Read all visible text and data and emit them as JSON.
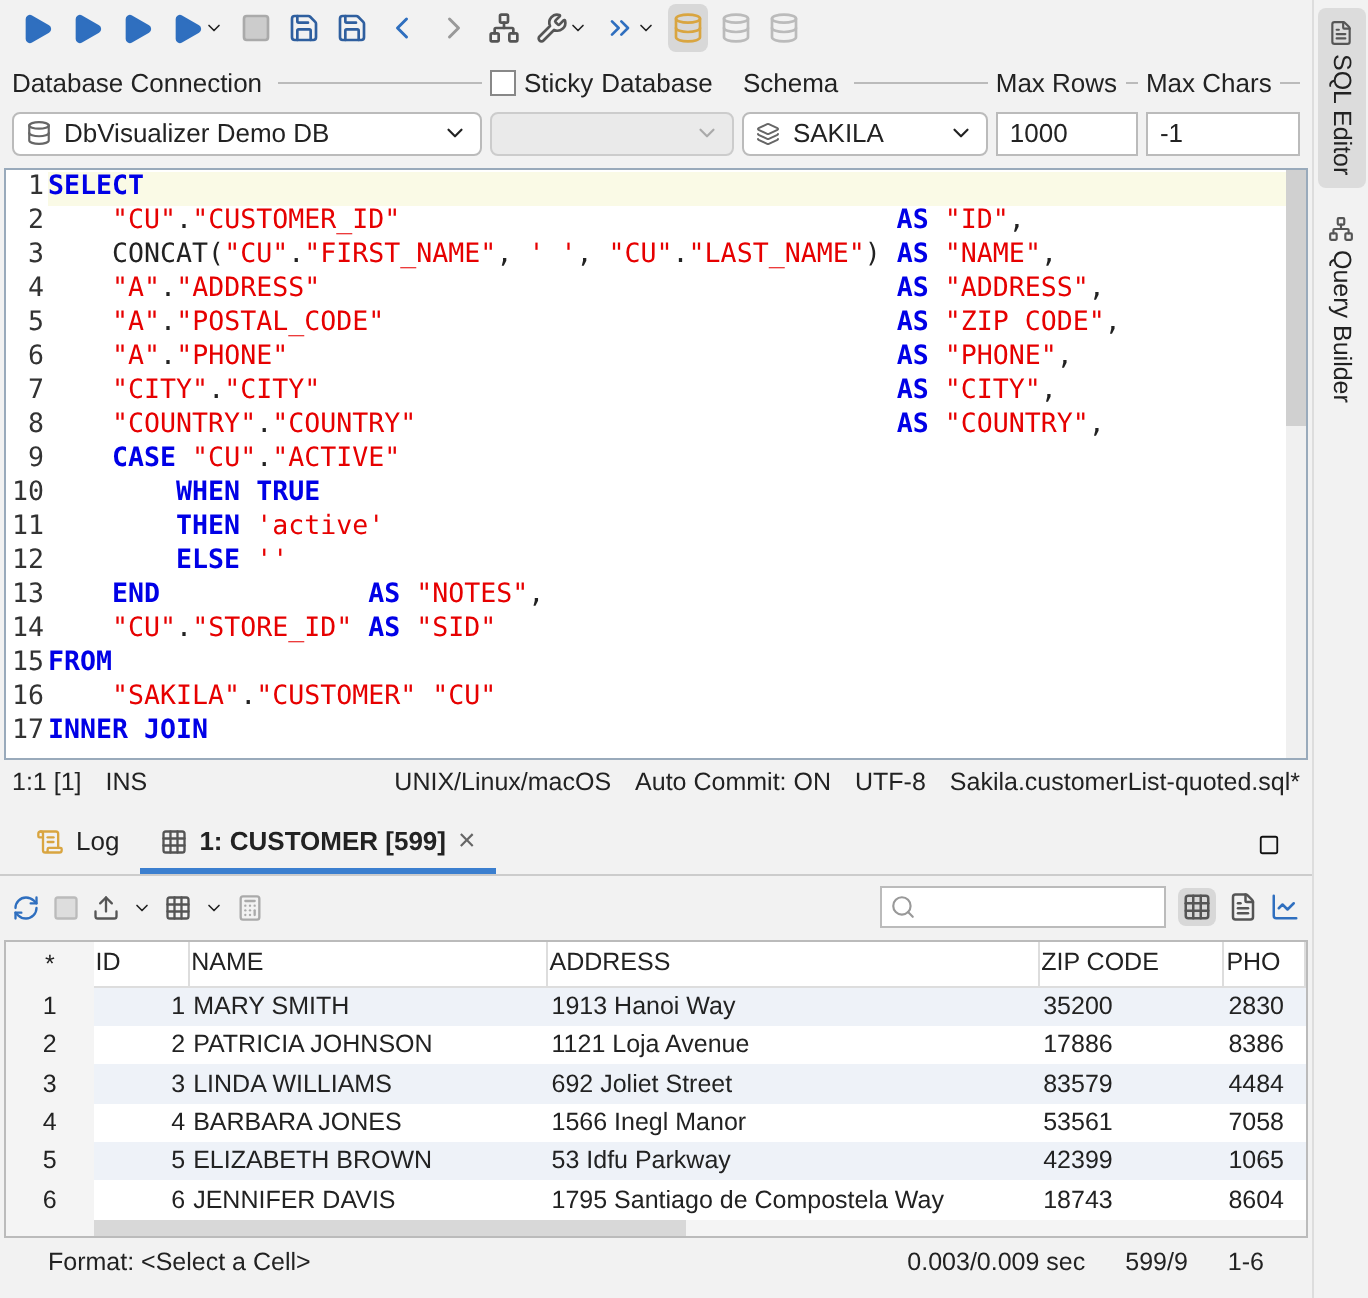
{
  "connection": {
    "label": "Database Connection",
    "value": "DbVisualizer Demo DB",
    "sticky": {
      "label": "Sticky",
      "checked": false
    }
  },
  "database": {
    "label": "Database"
  },
  "schema": {
    "label": "Schema",
    "value": "SAKILA"
  },
  "max_rows": {
    "label": "Max Rows",
    "value": "1000"
  },
  "max_chars": {
    "label": "Max Chars",
    "value": "-1"
  },
  "side_tabs": [
    {
      "label": "SQL Editor",
      "selected": true
    },
    {
      "label": "Query Builder",
      "selected": false
    }
  ],
  "editor": {
    "lines": [
      {
        "number": "1",
        "tokens": [
          {
            "kind": "kw",
            "text": "SELECT"
          }
        ]
      },
      {
        "number": "2",
        "tokens": [
          {
            "kind": "str",
            "text": "    \"CU\"",
            "suffix": "."
          },
          {
            "kind": "str",
            "text": "\"CUSTOMER_ID\""
          },
          {
            "kind": "kw",
            "text": "                               AS"
          },
          {
            "kind": "str",
            "text": " \"ID\"",
            "suffix": ","
          }
        ]
      },
      {
        "number": "3",
        "tokens": [
          {
            "kind": "plain",
            "text": "    CONCAT("
          },
          {
            "kind": "str",
            "text": "\"CU\"",
            "suffix": "."
          },
          {
            "kind": "str",
            "text": "\"FIRST_NAME\"",
            "suffix": ", "
          },
          {
            "kind": "str",
            "text": "' '",
            "suffix": ", "
          },
          {
            "kind": "str",
            "text": "\"CU\"",
            "suffix": "."
          },
          {
            "kind": "str",
            "text": "\"LAST_NAME\"",
            "suffix": ")"
          },
          {
            "kind": "kw",
            "text": " AS"
          },
          {
            "kind": "str",
            "text": " \"NAME\"",
            "suffix": ","
          }
        ]
      },
      {
        "number": "4",
        "tokens": [
          {
            "kind": "str",
            "text": "    \"A\"",
            "suffix": "."
          },
          {
            "kind": "str",
            "text": "\"ADDRESS\""
          },
          {
            "kind": "kw",
            "text": "                                    AS"
          },
          {
            "kind": "str",
            "text": " \"ADDRESS\"",
            "suffix": ","
          }
        ]
      },
      {
        "number": "5",
        "tokens": [
          {
            "kind": "str",
            "text": "    \"A\"",
            "suffix": "."
          },
          {
            "kind": "str",
            "text": "\"POSTAL_CODE\""
          },
          {
            "kind": "kw",
            "text": "                                AS"
          },
          {
            "kind": "str",
            "text": " \"ZIP CODE\"",
            "suffix": ","
          }
        ]
      },
      {
        "number": "6",
        "tokens": [
          {
            "kind": "str",
            "text": "    \"A\"",
            "suffix": "."
          },
          {
            "kind": "str",
            "text": "\"PHONE\""
          },
          {
            "kind": "kw",
            "text": "                                      AS"
          },
          {
            "kind": "str",
            "text": " \"PHONE\"",
            "suffix": ","
          }
        ]
      },
      {
        "number": "7",
        "tokens": [
          {
            "kind": "str",
            "text": "    \"CITY\"",
            "suffix": "."
          },
          {
            "kind": "str",
            "text": "\"CITY\""
          },
          {
            "kind": "kw",
            "text": "                                    AS"
          },
          {
            "kind": "str",
            "text": " \"CITY\"",
            "suffix": ","
          }
        ]
      },
      {
        "number": "8",
        "tokens": [
          {
            "kind": "str",
            "text": "    \"COUNTRY\"",
            "suffix": "."
          },
          {
            "kind": "str",
            "text": "\"COUNTRY\""
          },
          {
            "kind": "kw",
            "text": "                              AS"
          },
          {
            "kind": "str",
            "text": " \"COUNTRY\"",
            "suffix": ","
          }
        ]
      },
      {
        "number": "9",
        "tokens": [
          {
            "kind": "kw",
            "text": "    CASE"
          },
          {
            "kind": "str",
            "text": " \"CU\"",
            "suffix": "."
          },
          {
            "kind": "str",
            "text": "\"ACTIVE\""
          }
        ]
      },
      {
        "number": "10",
        "tokens": [
          {
            "kind": "kw",
            "text": "        WHEN TRUE"
          }
        ]
      },
      {
        "number": "11",
        "tokens": [
          {
            "kind": "kw",
            "text": "        THEN"
          },
          {
            "kind": "str",
            "text": " 'active'"
          }
        ]
      },
      {
        "number": "12",
        "tokens": [
          {
            "kind": "kw",
            "text": "        ELSE"
          },
          {
            "kind": "str",
            "text": " ''"
          }
        ]
      },
      {
        "number": "13",
        "tokens": [
          {
            "kind": "kw",
            "text": "    END             AS"
          },
          {
            "kind": "str",
            "text": " \"NOTES\"",
            "suffix": ","
          }
        ]
      },
      {
        "number": "14",
        "tokens": [
          {
            "kind": "str",
            "text": "    \"CU\"",
            "suffix": "."
          },
          {
            "kind": "str",
            "text": "\"STORE_ID\""
          },
          {
            "kind": "kw",
            "text": " AS"
          },
          {
            "kind": "str",
            "text": " \"SID\""
          }
        ]
      },
      {
        "number": "15",
        "tokens": [
          {
            "kind": "kw",
            "text": "FROM"
          }
        ]
      },
      {
        "number": "16",
        "tokens": [
          {
            "kind": "str",
            "text": "    \"SAKILA\"",
            "suffix": "."
          },
          {
            "kind": "str",
            "text": "\"CUSTOMER\" \"CU\""
          }
        ]
      },
      {
        "number": "17",
        "tokens": [
          {
            "kind": "kw",
            "text": "INNER JOIN"
          }
        ]
      }
    ]
  },
  "editor_status": [
    "1:1 [1]",
    "INS",
    "UNIX/Linux/macOS",
    "Auto Commit: ON",
    "UTF-8",
    "Sakila.customerList-quoted.sql*"
  ],
  "result_tabs": [
    {
      "kind": "log",
      "label": "Log",
      "selected": false
    },
    {
      "kind": "grid",
      "label": "1: CUSTOMER [599]",
      "selected": true,
      "close": "×"
    }
  ],
  "grid": {
    "corner": "*",
    "columns": [
      "ID",
      "NAME",
      "ADDRESS",
      "ZIP CODE",
      "PHO"
    ],
    "rows": [
      {
        "header": "1",
        "cells": [
          "1",
          "MARY SMITH",
          "1913 Hanoi Way",
          "35200",
          "2830"
        ]
      },
      {
        "header": "2",
        "cells": [
          "2",
          "PATRICIA JOHNSON",
          "1121 Loja Avenue",
          "17886",
          "8386"
        ]
      },
      {
        "header": "3",
        "cells": [
          "3",
          "LINDA WILLIAMS",
          "692 Joliet Street",
          "83579",
          "4484"
        ]
      },
      {
        "header": "4",
        "cells": [
          "4",
          "BARBARA JONES",
          "1566 Inegl Manor",
          "53561",
          "7058"
        ]
      },
      {
        "header": "5",
        "cells": [
          "5",
          "ELIZABETH BROWN",
          "53 Idfu Parkway",
          "42399",
          "1065"
        ]
      },
      {
        "header": "6",
        "cells": [
          "6",
          "JENNIFER DAVIS",
          "1795 Santiago de Compostela Way",
          "18743",
          "8604"
        ]
      }
    ]
  },
  "footer": {
    "format": "Format: <Select a Cell>",
    "timing": "0.003/0.009 sec",
    "size": "599/9",
    "range": "1-6"
  }
}
